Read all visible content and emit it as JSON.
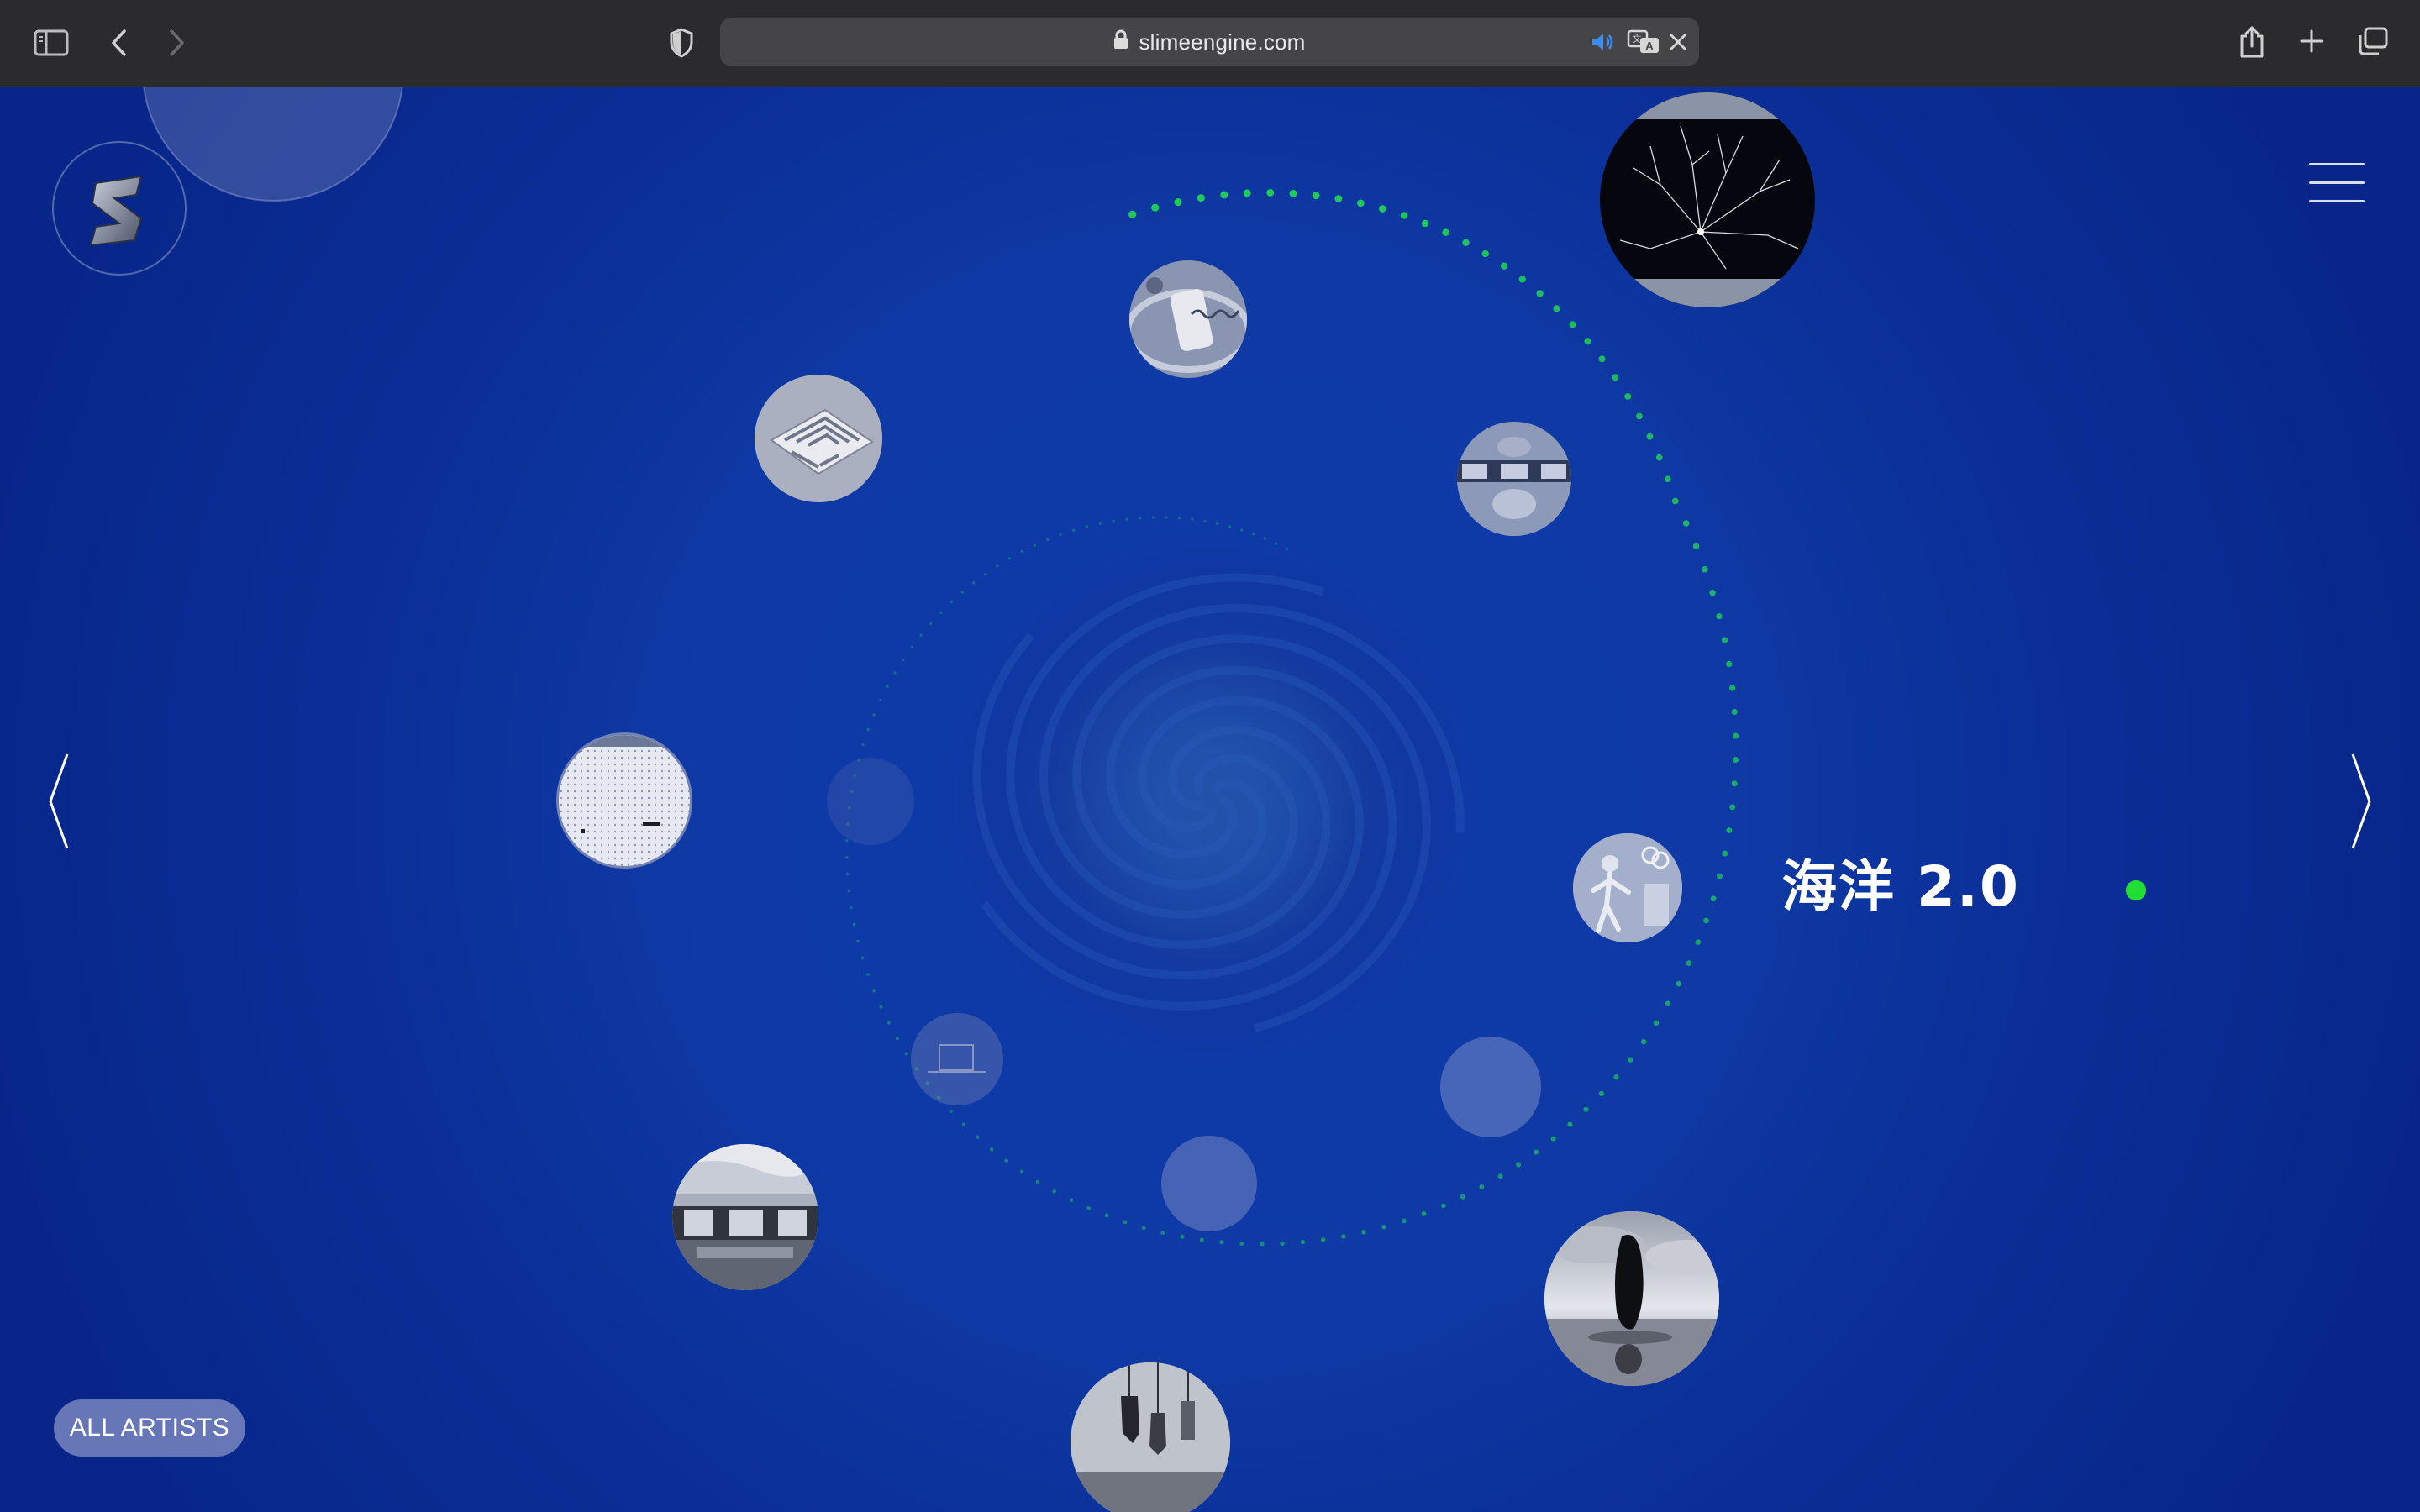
{
  "browser": {
    "url": "slimeengine.com",
    "icons": {
      "sidebar": "sidebar-icon",
      "back": "back-chevron-icon",
      "forward": "forward-chevron-icon",
      "privacy": "shield-icon",
      "lock": "lock-icon",
      "audio": "speaker-icon",
      "translate": "translate-icon",
      "close": "close-icon",
      "share": "share-icon",
      "new_tab": "plus-icon",
      "tabs": "tab-overview-icon"
    }
  },
  "site": {
    "logo": "slime-engine-logo",
    "menu_icon": "hamburger-menu-icon",
    "prev_icon": "chevron-left-icon",
    "next_icon": "chevron-right-icon",
    "featured_title": "海洋 2.0",
    "all_artists_label": "ALL ARTISTS"
  },
  "colors": {
    "background": "#0c2f98",
    "accent_dot": "#22dd33",
    "spiral_dots": "#1fc95a",
    "button": "#8c96c8"
  },
  "artworks": [
    "network-lines-artwork",
    "signature-ring-artwork",
    "maze-artwork",
    "room-windows-artwork",
    "dotted-grid-artwork",
    "figures-artwork",
    "windows-room-artwork",
    "black-monolith-artwork",
    "hanging-objects-artwork"
  ]
}
